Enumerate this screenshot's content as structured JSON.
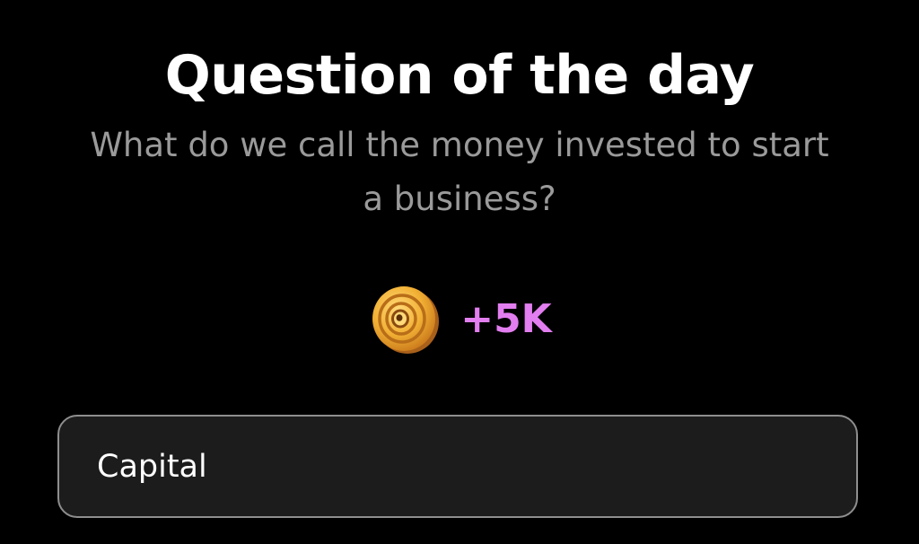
{
  "header": {
    "title": "Question of the day",
    "question": "What do we call the money invested to start a business?"
  },
  "reward": {
    "icon": "coin-icon",
    "amount": "+5K",
    "amount_color": "#e27ef0",
    "coin_color": "#f2b135"
  },
  "answer": {
    "value": "Capital"
  },
  "colors": {
    "background": "#000000",
    "question_text": "#9a9a9a",
    "input_border": "#8e8e8e",
    "input_background": "#1c1c1c"
  }
}
